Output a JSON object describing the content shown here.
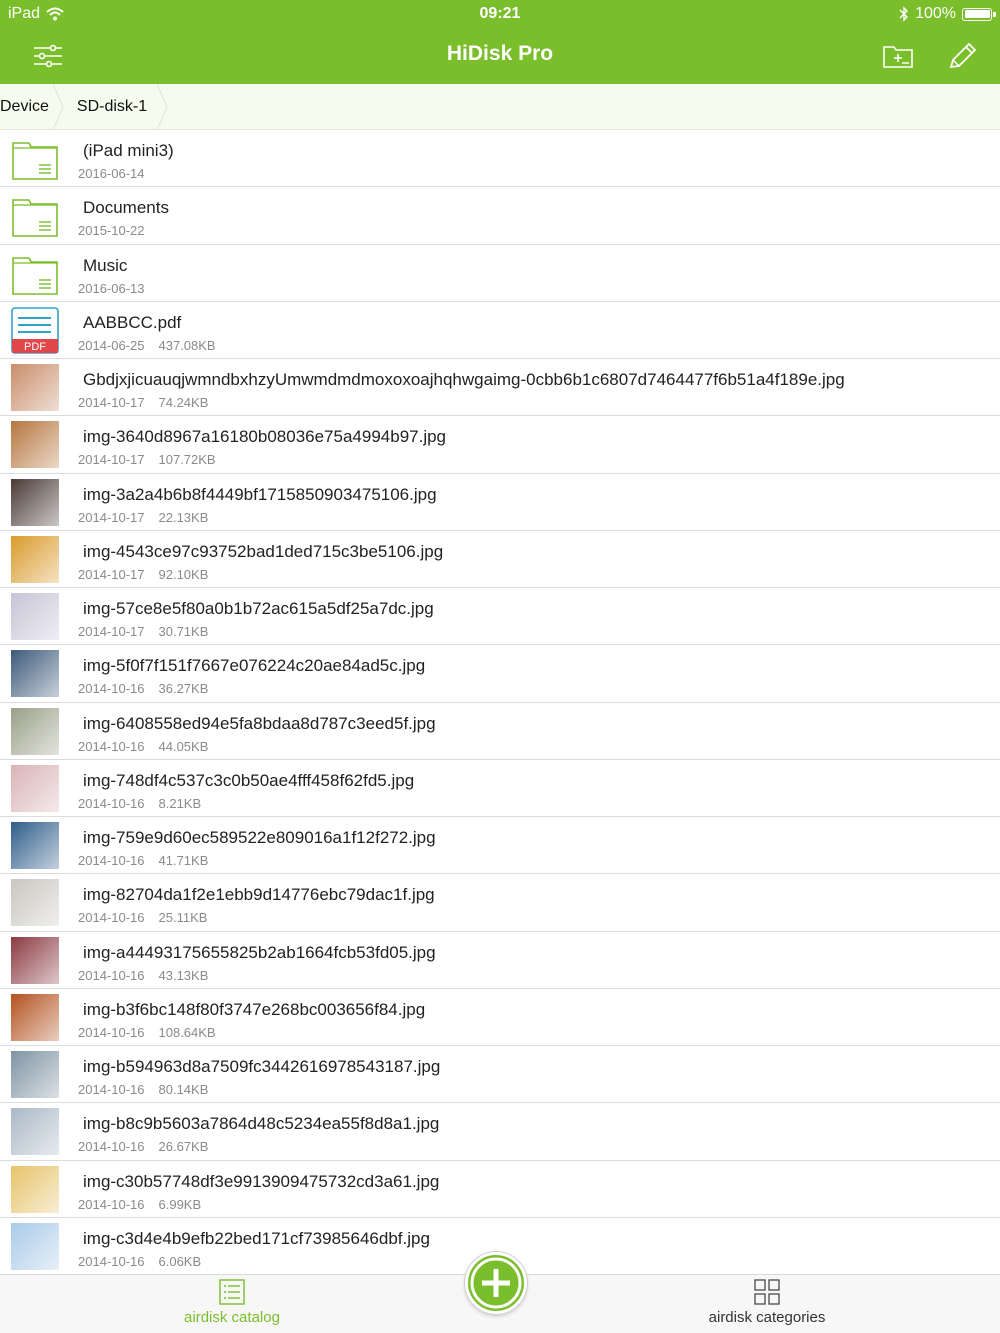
{
  "status_bar": {
    "device": "iPad",
    "time": "09:21",
    "battery": "100%"
  },
  "nav": {
    "title": "HiDisk Pro",
    "menu_icon": "sliders-icon",
    "new_folder_icon": "new-folder-icon",
    "edit_icon": "pencil-icon"
  },
  "breadcrumb": [
    "Device",
    "SD-disk-1"
  ],
  "files": [
    {
      "name": "(iPad mini3)",
      "date": "2016-06-14",
      "size": "",
      "kind": "folder"
    },
    {
      "name": "Documents",
      "date": "2015-10-22",
      "size": "",
      "kind": "folder"
    },
    {
      "name": "Music",
      "date": "2016-06-13",
      "size": "",
      "kind": "folder"
    },
    {
      "name": "AABBCC.pdf",
      "date": "2014-06-25",
      "size": "437.08KB",
      "kind": "pdf"
    },
    {
      "name": "GbdjxjicuauqjwmndbxhzyUmwmdmdmoxoxoajhqhwgaimg-0cbb6b1c6807d7464477f6b51a4f189e.jpg",
      "date": "2014-10-17",
      "size": "74.24KB",
      "kind": "image",
      "tone": "#c98d6a"
    },
    {
      "name": "img-3640d8967a16180b08036e75a4994b97.jpg",
      "date": "2014-10-17",
      "size": "107.72KB",
      "kind": "image",
      "tone": "#b5763f"
    },
    {
      "name": "img-3a2a4b6b8f4449bf1715850903475106.jpg",
      "date": "2014-10-17",
      "size": "22.13KB",
      "kind": "image",
      "tone": "#4a3a35"
    },
    {
      "name": "img-4543ce97c93752bad1ded715c3be5106.jpg",
      "date": "2014-10-17",
      "size": "92.10KB",
      "kind": "image",
      "tone": "#d99a2b"
    },
    {
      "name": "img-57ce8e5f80a0b1b72ac615a5df25a7dc.jpg",
      "date": "2014-10-17",
      "size": "30.71KB",
      "kind": "image",
      "tone": "#c7c3d6"
    },
    {
      "name": "img-5f0f7f151f7667e076224c20ae84ad5c.jpg",
      "date": "2014-10-16",
      "size": "36.27KB",
      "kind": "image",
      "tone": "#3d5a7a"
    },
    {
      "name": "img-6408558ed94e5fa8bdaa8d787c3eed5f.jpg",
      "date": "2014-10-16",
      "size": "44.05KB",
      "kind": "image",
      "tone": "#9aa089"
    },
    {
      "name": "img-748df4c537c3c0b50ae4fff458f62fd5.jpg",
      "date": "2014-10-16",
      "size": "8.21KB",
      "kind": "image",
      "tone": "#d9b3b6"
    },
    {
      "name": "img-759e9d60ec589522e809016a1f12f272.jpg",
      "date": "2014-10-16",
      "size": "41.71KB",
      "kind": "image",
      "tone": "#2f5d8a"
    },
    {
      "name": "img-82704da1f2e1ebb9d14776ebc79dac1f.jpg",
      "date": "2014-10-16",
      "size": "25.11KB",
      "kind": "image",
      "tone": "#c9c6bf"
    },
    {
      "name": "img-a44493175655825b2ab1664fcb53fd05.jpg",
      "date": "2014-10-16",
      "size": "43.13KB",
      "kind": "image",
      "tone": "#8a3a42"
    },
    {
      "name": "img-b3f6bc148f80f3747e268bc003656f84.jpg",
      "date": "2014-10-16",
      "size": "108.64KB",
      "kind": "image",
      "tone": "#b3521f"
    },
    {
      "name": "img-b594963d8a7509fc3442616978543187.jpg",
      "date": "2014-10-16",
      "size": "80.14KB",
      "kind": "image",
      "tone": "#7f93a3"
    },
    {
      "name": "img-b8c9b5603a7864d48c5234ea55f8d8a1.jpg",
      "date": "2014-10-16",
      "size": "26.67KB",
      "kind": "image",
      "tone": "#aab8c6"
    },
    {
      "name": "img-c30b57748df3e9913909475732cd3a61.jpg",
      "date": "2014-10-16",
      "size": "6.99KB",
      "kind": "image",
      "tone": "#e6c36a"
    },
    {
      "name": "img-c3d4e4b9efb22bed171cf73985646dbf.jpg",
      "date": "2014-10-16",
      "size": "6.06KB",
      "kind": "image",
      "tone": "#a9cbe8"
    }
  ],
  "bottom_tabs": {
    "catalog_label": "airdisk catalog",
    "categories_label": "airdisk categories"
  },
  "colors": {
    "accent": "#7bbe2c",
    "folder_stroke": "#7bbe2c",
    "pdf_red": "#e0464a",
    "pdf_teal": "#2fa3c7"
  }
}
